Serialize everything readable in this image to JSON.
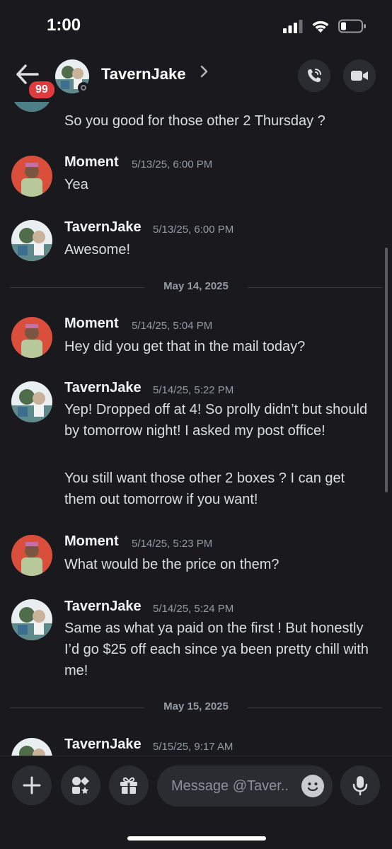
{
  "status_bar": {
    "time": "1:00"
  },
  "header": {
    "channel_name": "TavernJake",
    "badge_count": "99",
    "icons": {
      "back": "back-arrow-icon",
      "chevron": "chevron-right-icon",
      "call": "phone-call-icon",
      "video": "video-camera-icon"
    }
  },
  "messages": [
    {
      "type": "continuation",
      "text": "So you good for those other 2 Thursday ?"
    },
    {
      "type": "group",
      "author": "Moment",
      "timestamp": "5/13/25, 6:00 PM",
      "lines": [
        "Yea"
      ]
    },
    {
      "type": "group",
      "author": "TavernJake",
      "timestamp": "5/13/25, 6:00 PM",
      "lines": [
        "Awesome!"
      ]
    },
    {
      "type": "divider",
      "label": "May 14, 2025"
    },
    {
      "type": "group",
      "author": "Moment",
      "timestamp": "5/14/25, 5:04 PM",
      "lines": [
        "Hey did you get that in the mail today?"
      ]
    },
    {
      "type": "group",
      "author": "TavernJake",
      "timestamp": "5/14/25, 5:22 PM",
      "lines": [
        "Yep! Dropped off at 4! So prolly didn’t but should by tomorrow night! I asked my post office!",
        "You still want those other 2 boxes ? I can get them out tomorrow if you want!"
      ]
    },
    {
      "type": "group",
      "author": "Moment",
      "timestamp": "5/14/25, 5:23 PM",
      "lines": [
        "What would be the price on them?"
      ]
    },
    {
      "type": "group",
      "author": "TavernJake",
      "timestamp": "5/14/25, 5:24 PM",
      "lines": [
        "Same as what ya paid on the first ! But honestly I’d go $25 off each since ya been pretty chill with me!"
      ]
    },
    {
      "type": "divider",
      "label": "May 15, 2025"
    },
    {
      "type": "group",
      "author": "TavernJake",
      "timestamp": "5/15/25, 9:17 AM",
      "lines": []
    }
  ],
  "composer": {
    "placeholder": "Message @Taver..",
    "icons": {
      "add": "plus-icon",
      "apps": "apps-icon",
      "gift": "gift-icon",
      "emoji": "emoji-icon",
      "mic": "microphone-icon"
    }
  },
  "colors": {
    "background": "#1a1a1e",
    "badge": "#e03a3e",
    "button_bg": "#2b2c32",
    "moment_avatar": "#d94f3c"
  }
}
